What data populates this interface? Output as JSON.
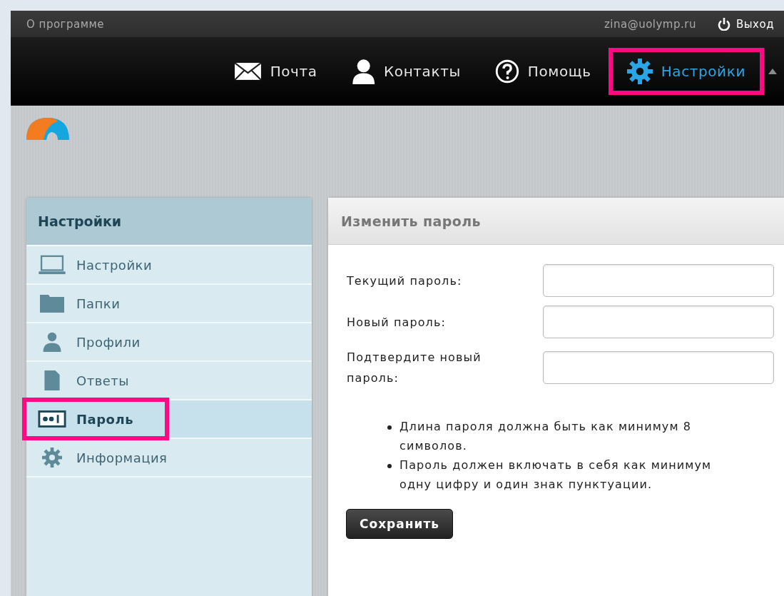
{
  "top_bar": {
    "about_link": "О программе",
    "user_email": "zina@uolymp.ru",
    "logout": "Выход"
  },
  "nav": [
    {
      "label": "Почта",
      "kind": "mail",
      "selected": false,
      "highlighted": false
    },
    {
      "label": "Контакты",
      "kind": "contacts",
      "selected": false,
      "highlighted": false
    },
    {
      "label": "Помощь",
      "kind": "help",
      "selected": false,
      "highlighted": false
    },
    {
      "label": "Настройки",
      "kind": "settings",
      "selected": true,
      "highlighted": true
    }
  ],
  "sidebar": {
    "title": "Настройки",
    "items": [
      {
        "label": "Настройки",
        "kind": "laptop",
        "selected": false,
        "highlighted": false
      },
      {
        "label": "Папки",
        "kind": "folder",
        "selected": false,
        "highlighted": false
      },
      {
        "label": "Профили",
        "kind": "person",
        "selected": false,
        "highlighted": false
      },
      {
        "label": "Ответы",
        "kind": "document",
        "selected": false,
        "highlighted": false
      },
      {
        "label": "Пароль",
        "kind": "password",
        "selected": true,
        "highlighted": true
      },
      {
        "label": "Информация",
        "kind": "gear",
        "selected": false,
        "highlighted": false
      }
    ]
  },
  "panel": {
    "title": "Изменить пароль",
    "fields": [
      {
        "label": "Текущий пароль:"
      },
      {
        "label": "Новый пароль:"
      },
      {
        "label": "Подтвердите новый пароль:"
      }
    ],
    "rules": [
      "Длина пароля должна быть как минимум 8 символов.",
      "Пароль должен включать в себя как минимум одну цифру и один знак пунктуации."
    ],
    "save_button": "Сохранить"
  }
}
